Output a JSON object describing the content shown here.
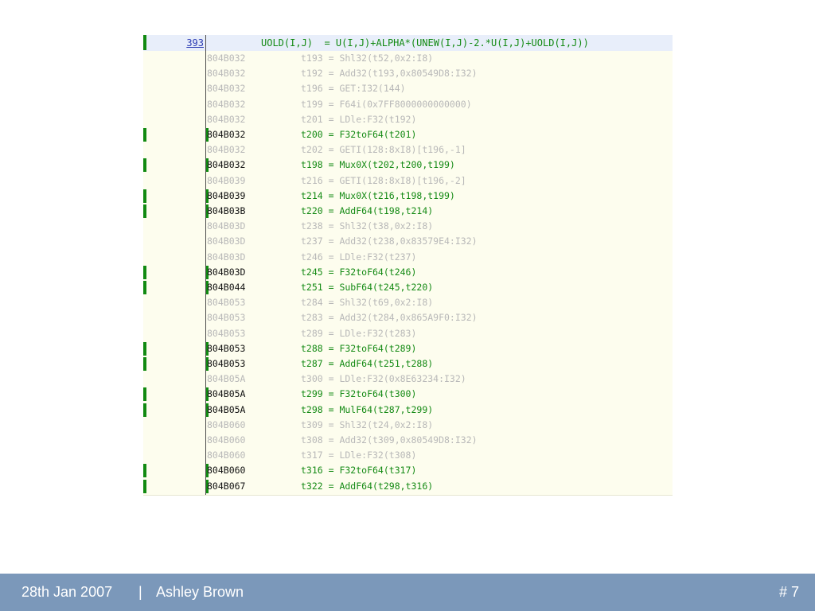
{
  "code": {
    "source_line": {
      "number": "393",
      "text": "UOLD(I,J)  = U(I,J)+ALPHA*(UNEW(I,J)-2.*U(I,J)+UOLD(I,J))"
    },
    "rows": [
      {
        "addr": "804B032",
        "stmt": "t193 = Shl32(t52,0x2:I8)",
        "highlight": false
      },
      {
        "addr": "804B032",
        "stmt": "t192 = Add32(t193,0x80549D8:I32)",
        "highlight": false
      },
      {
        "addr": "804B032",
        "stmt": "t196 = GET:I32(144)",
        "highlight": false
      },
      {
        "addr": "804B032",
        "stmt": "t199 = F64i(0x7FF8000000000000)",
        "highlight": false
      },
      {
        "addr": "804B032",
        "stmt": "t201 = LDle:F32(t192)",
        "highlight": false
      },
      {
        "addr": "804B032",
        "stmt": "t200 = F32toF64(t201)",
        "highlight": true
      },
      {
        "addr": "804B032",
        "stmt": "t202 = GETI(128:8xI8)[t196,-1]",
        "highlight": false
      },
      {
        "addr": "804B032",
        "stmt": "t198 = Mux0X(t202,t200,t199)",
        "highlight": true
      },
      {
        "addr": "804B039",
        "stmt": "t216 = GETI(128:8xI8)[t196,-2]",
        "highlight": false
      },
      {
        "addr": "804B039",
        "stmt": "t214 = Mux0X(t216,t198,t199)",
        "highlight": true
      },
      {
        "addr": "804B03B",
        "stmt": "t220 = AddF64(t198,t214)",
        "highlight": true
      },
      {
        "addr": "804B03D",
        "stmt": "t238 = Shl32(t38,0x2:I8)",
        "highlight": false
      },
      {
        "addr": "804B03D",
        "stmt": "t237 = Add32(t238,0x83579E4:I32)",
        "highlight": false
      },
      {
        "addr": "804B03D",
        "stmt": "t246 = LDle:F32(t237)",
        "highlight": false
      },
      {
        "addr": "804B03D",
        "stmt": "t245 = F32toF64(t246)",
        "highlight": true
      },
      {
        "addr": "804B044",
        "stmt": "t251 = SubF64(t245,t220)",
        "highlight": true
      },
      {
        "addr": "804B053",
        "stmt": "t284 = Shl32(t69,0x2:I8)",
        "highlight": false
      },
      {
        "addr": "804B053",
        "stmt": "t283 = Add32(t284,0x865A9F0:I32)",
        "highlight": false
      },
      {
        "addr": "804B053",
        "stmt": "t289 = LDle:F32(t283)",
        "highlight": false
      },
      {
        "addr": "804B053",
        "stmt": "t288 = F32toF64(t289)",
        "highlight": true
      },
      {
        "addr": "804B053",
        "stmt": "t287 = AddF64(t251,t288)",
        "highlight": true
      },
      {
        "addr": "804B05A",
        "stmt": "t300 = LDle:F32(0x8E63234:I32)",
        "highlight": false
      },
      {
        "addr": "804B05A",
        "stmt": "t299 = F32toF64(t300)",
        "highlight": true
      },
      {
        "addr": "804B05A",
        "stmt": "t298 = MulF64(t287,t299)",
        "highlight": true
      },
      {
        "addr": "804B060",
        "stmt": "t309 = Shl32(t24,0x2:I8)",
        "highlight": false
      },
      {
        "addr": "804B060",
        "stmt": "t308 = Add32(t309,0x80549D8:I32)",
        "highlight": false
      },
      {
        "addr": "804B060",
        "stmt": "t317 = LDle:F32(t308)",
        "highlight": false
      },
      {
        "addr": "804B060",
        "stmt": "t316 = F32toF64(t317)",
        "highlight": true
      },
      {
        "addr": "804B067",
        "stmt": "t322 = AddF64(t298,t316)",
        "highlight": true
      }
    ]
  },
  "footer": {
    "date": "28th Jan 2007",
    "separator": "|",
    "author": "Ashley Brown",
    "page": "# 7"
  },
  "colors": {
    "highlight_green": "#118a11",
    "dim_text": "#b8b8b8",
    "panel_bg": "#fdfdee",
    "header_bg": "#e8eefa",
    "footer_bg": "#7b98ba"
  }
}
